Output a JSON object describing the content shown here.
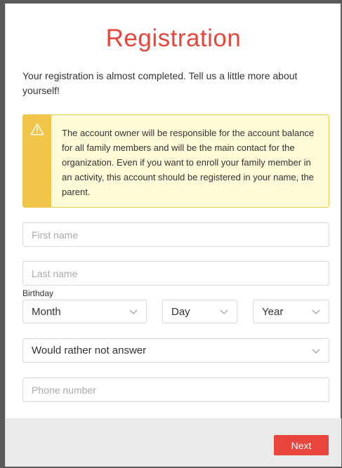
{
  "title": "Registration",
  "intro": "Your registration is almost completed. Tell us a little more about yourself!",
  "notice": {
    "icon": "warning-triangle-icon",
    "text": "The account owner will be responsible for the account balance for all family members and will be the main contact for the organization. Even if you want to enroll your family member in an activity, this account should be registered in your name, the parent."
  },
  "form": {
    "first_name_placeholder": "First name",
    "last_name_placeholder": "Last name",
    "birthday_label": "Birthday",
    "month_value": "Month",
    "day_value": "Day",
    "year_value": "Year",
    "gender_value": "Would rather not answer",
    "phone_placeholder": "Phone number"
  },
  "footer": {
    "next_label": "Next"
  },
  "colors": {
    "accent": "#e8453c",
    "notice_bg": "#fffbd8",
    "notice_border": "#f0c94a"
  }
}
